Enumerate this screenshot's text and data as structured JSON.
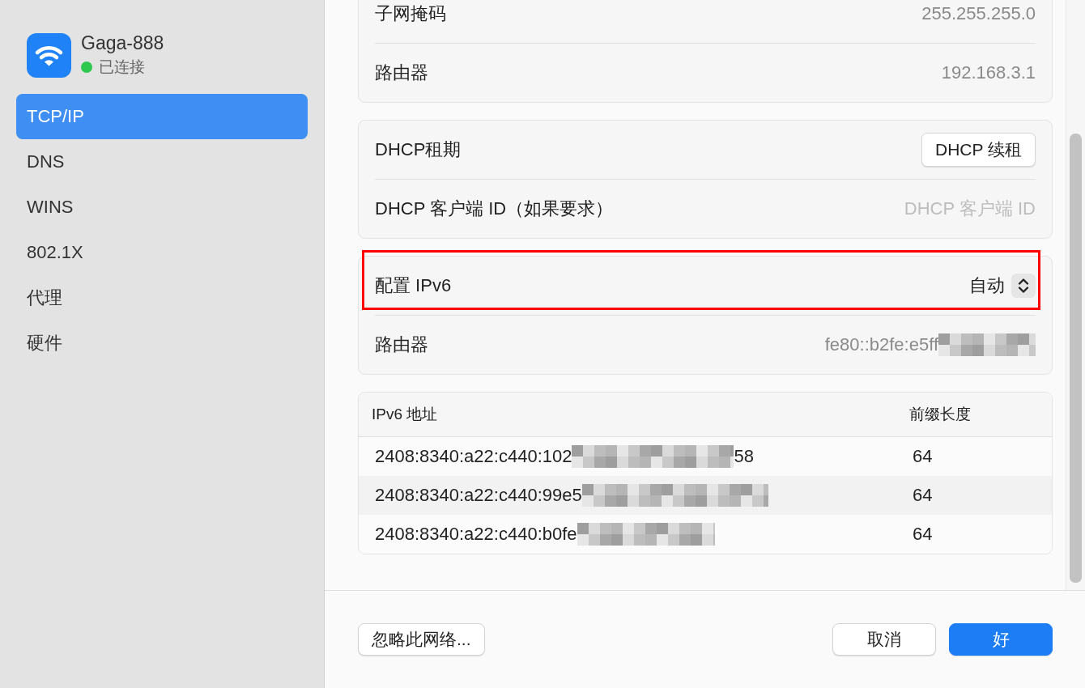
{
  "network": {
    "name": "Gaga-888",
    "status": "已连接",
    "connected": true
  },
  "sidebar": {
    "items": [
      {
        "label": "TCP/IP",
        "selected": true
      },
      {
        "label": "DNS",
        "selected": false
      },
      {
        "label": "WINS",
        "selected": false
      },
      {
        "label": "802.1X",
        "selected": false
      },
      {
        "label": "代理",
        "selected": false
      },
      {
        "label": "硬件",
        "selected": false
      }
    ]
  },
  "sections": [
    {
      "rows": [
        {
          "kind": "value",
          "label": "子网掩码",
          "value": "255.255.255.0",
          "redacted": false,
          "highlighted": false
        },
        {
          "kind": "value",
          "label": "路由器",
          "value": "192.168.3.1",
          "redacted": false,
          "highlighted": false
        }
      ]
    },
    {
      "rows": [
        {
          "kind": "button",
          "label": "DHCP租期",
          "button": "DHCP 续租",
          "highlighted": false
        },
        {
          "kind": "field",
          "label": "DHCP 客户端 ID（如果要求）",
          "placeholder": "DHCP 客户端 ID",
          "highlighted": false
        }
      ]
    },
    {
      "rows": [
        {
          "kind": "popup",
          "label": "配置 IPv6",
          "value": "自动",
          "highlighted": true
        },
        {
          "kind": "value",
          "label": "路由器",
          "value": "fe80::b2fe:e5ff",
          "redacted": true,
          "highlighted": false
        }
      ]
    }
  ],
  "ipv6_table": {
    "columns": [
      "IPv6 地址",
      "前缀长度"
    ],
    "rows": [
      {
        "address": "2408:8340:a22:c440:102",
        "address_end": "58",
        "redacted": true,
        "prefix": "64"
      },
      {
        "address": "2408:8340:a22:c440:99e5",
        "redacted": true,
        "prefix": "64"
      },
      {
        "address": "2408:8340:a22:c440:b0fe",
        "redacted": true,
        "prefix": "64"
      }
    ]
  },
  "buttons": {
    "forget": "忽略此网络...",
    "cancel": "取消",
    "ok": "好"
  }
}
